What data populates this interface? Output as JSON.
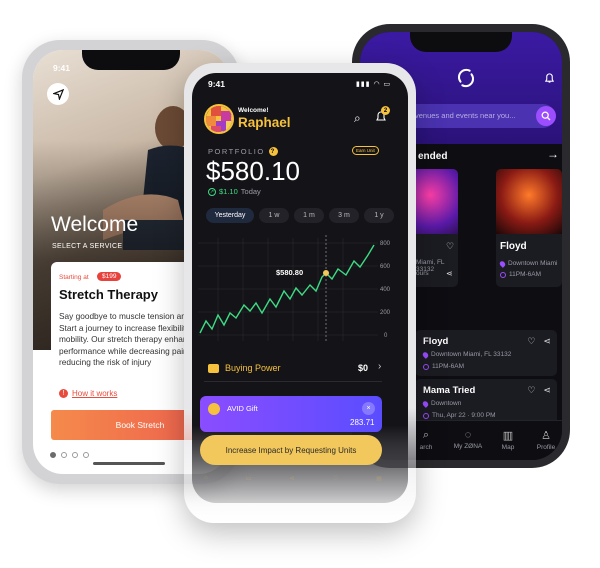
{
  "left_app": {
    "status_time": "9:41",
    "welcome": "Welcome",
    "select_service": "SELECT A SERVICE",
    "starting_at": "Starting at",
    "price": "$199",
    "card_title": "Stretch Therapy",
    "card_body": "Say goodbye to muscle tension and tightness! Start a journey to increase flexibility and mobility. Our stretch therapy enhances performance while decreasing pain and reducing the risk of injury",
    "how_link": "How it works",
    "book_button": "Book Stretch",
    "page_dots": 4,
    "active_dot": 0,
    "accent": "#e84c3d"
  },
  "center_app": {
    "status_time": "9:41",
    "welcome": "Welcome!",
    "user": "Raphael",
    "notification_count": "2",
    "portfolio_label": "PORTFOLIO",
    "earn_chip": "Earn Unit",
    "balance": "$580.10",
    "gain": "$1.10",
    "gain_period": "Today",
    "ranges": [
      "Yesterday",
      "1 w",
      "1 m",
      "3 m",
      "1 y"
    ],
    "active_range": "Yesterday",
    "chart_label": "$580.80",
    "chart_y_ticks": [
      "800",
      "600",
      "400",
      "200",
      "0"
    ],
    "buying_power_label": "Buying Power",
    "buying_power_value": "$0",
    "gift_name": "AVID Gift",
    "gift_value": "283.71",
    "impact_button": "Increase Impact by Requesting Units",
    "accent": "#f6c13d",
    "positive": "#3ddc84"
  },
  "right_app": {
    "search_placeholder": "venues and events near you...",
    "section_title": "ended",
    "events": [
      {
        "name": "",
        "address": "Miami, FL 33132",
        "time": "ours"
      },
      {
        "name": "Floyd",
        "address": "Downtown Miami",
        "time": "11PM-6AM"
      }
    ],
    "list": [
      {
        "name": "Floyd",
        "address": "Downtown Miami, FL 33132",
        "time": "11PM-6AM"
      },
      {
        "name": "Mama Tried",
        "address": "Downtown",
        "time": "Thu, Apr 22 · 9:00 PM"
      }
    ],
    "tabs": [
      "arch",
      "My ZØNA",
      "Map",
      "Profile"
    ],
    "accent": "#9b4dff"
  }
}
